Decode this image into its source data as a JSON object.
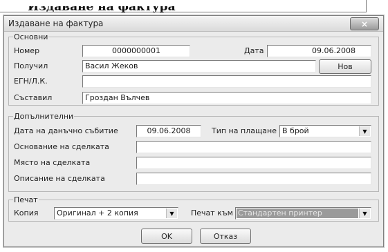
{
  "document": {
    "heading": "Издаване на фактура"
  },
  "window": {
    "title": "Издаване на фактура",
    "close_glyph": "×"
  },
  "groups": {
    "basic": {
      "title": "Основни",
      "number_label": "Номер",
      "number_value": "0000000001",
      "date_label": "Дата",
      "date_value": "09.06.2008",
      "recipient_label": "Получил",
      "recipient_value": "Васил Жеков",
      "new_button": "Нов",
      "egn_label": "ЕГН/Л.К.",
      "egn_value": "",
      "compiled_label": "Съставил",
      "compiled_value": "Гроздан Вълчев"
    },
    "additional": {
      "title": "Допълнителни",
      "tax_date_label": "Дата на данъчно събитие",
      "tax_date_value": "09.06.2008",
      "payment_type_label": "Тип на плащане",
      "payment_type_value": "В брой",
      "basis_label": "Основание на сделката",
      "basis_value": "",
      "place_label": "Място на сделката",
      "place_value": "",
      "description_label": "Описание на сделката",
      "description_value": ""
    },
    "print": {
      "title": "Печат",
      "copy_label": "Копия",
      "copy_value": "Оригинал + 2 копия",
      "print_to_label": "Печат към",
      "print_to_value": "Стандартен принтер"
    }
  },
  "buttons": {
    "ok": "OK",
    "cancel": "Отказ"
  },
  "icons": {
    "close": "close-icon",
    "dropdown": "chevron-down-icon"
  }
}
